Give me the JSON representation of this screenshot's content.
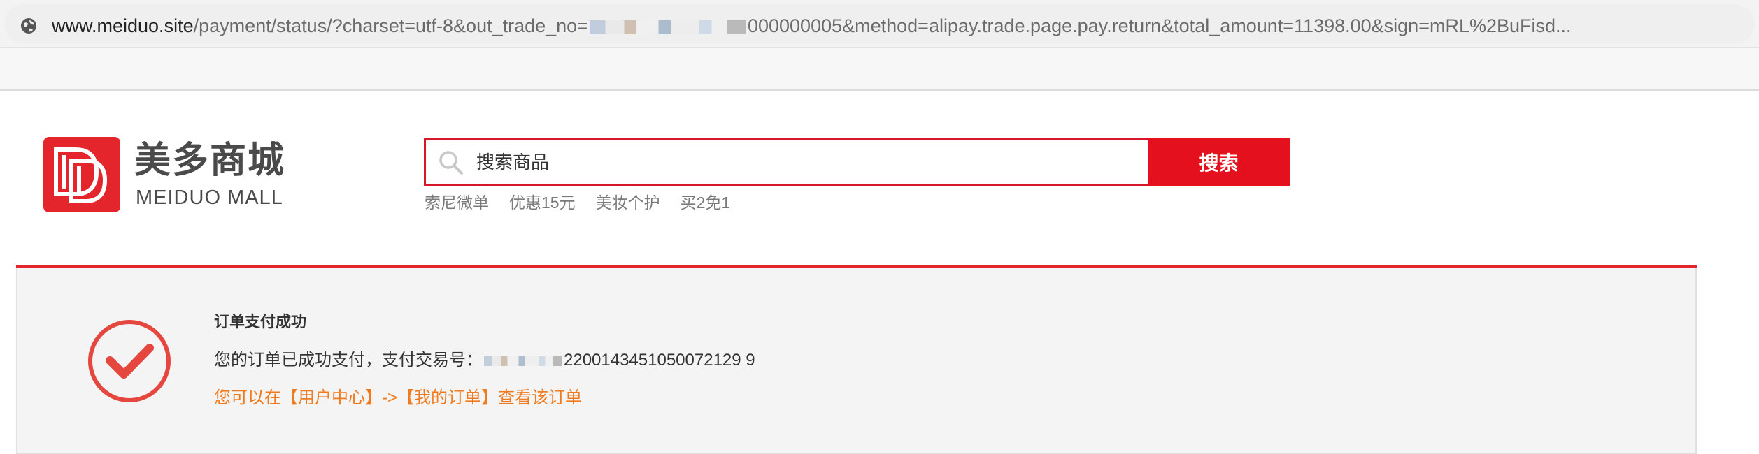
{
  "browser": {
    "url_host": "www.meiduo.site",
    "url_path_before": "/payment/status/?charset=utf-8&out_trade_no=",
    "url_path_after": "000000005&method=alipay.trade.page.pay.return&total_amount=11398.00&sign=mRL%2BuFisd..."
  },
  "header": {
    "logo_cn": "美多商城",
    "logo_en": "MEIDUO MALL",
    "search": {
      "placeholder": "搜索商品",
      "button_label": "搜索"
    },
    "hot_words": [
      "索尼微单",
      "优惠15元",
      "美妆个护",
      "买2免1"
    ]
  },
  "payment": {
    "title": "订单支付成功",
    "info_prefix": "您的订单已成功支付，支付交易号：",
    "trade_no_suffix": "2200143451050072129 9",
    "link_text": "您可以在【用户中心】->【我的订单】查看该订单"
  },
  "colors": {
    "brand_red": "#e4262c",
    "button_red": "#e4101e",
    "link_orange": "#f07b1f"
  }
}
